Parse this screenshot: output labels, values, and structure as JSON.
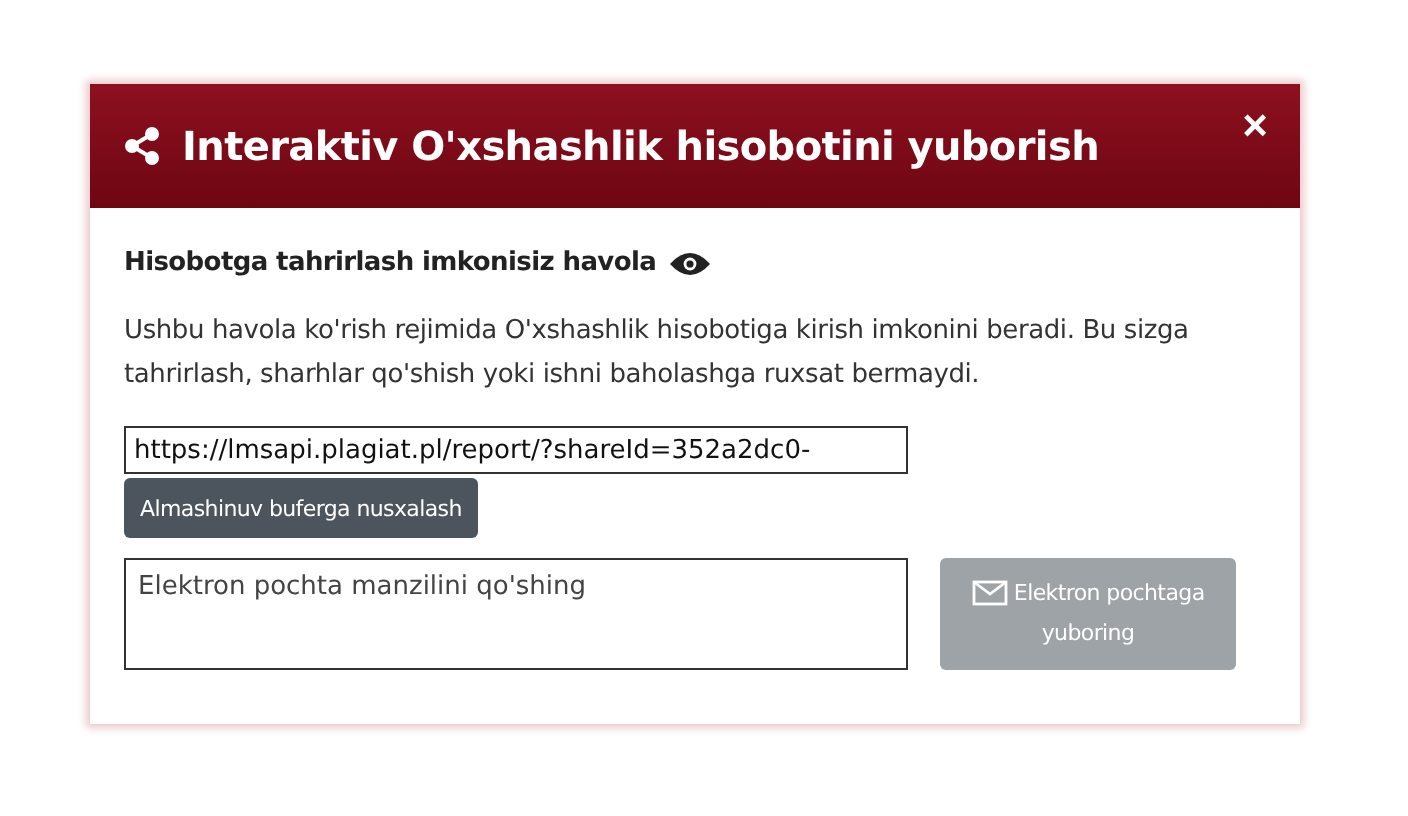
{
  "dialog": {
    "title": "Interaktiv O'xshashlik hisobotini yuborish",
    "close": "×"
  },
  "section": {
    "heading": "Hisobotga tahrirlash imkonisiz havola",
    "description": "Ushbu havola ko'rish rejimida O'xshashlik hisobotiga kirish imkonini beradi. Bu sizga tahrirlash, sharhlar qo'shish yoki ishni baholashga ruxsat bermaydi."
  },
  "link_field": {
    "value": "https://lmsapi.plagiat.pl/report/?shareId=352a2dc0-"
  },
  "copy_button": {
    "label": "Almashinuv buferga nusxalash"
  },
  "email_field": {
    "placeholder": "Elektron pochta manzilini qo'shing"
  },
  "send_button": {
    "label": "Elektron pochtaga yuboring",
    "disabled": true
  }
}
